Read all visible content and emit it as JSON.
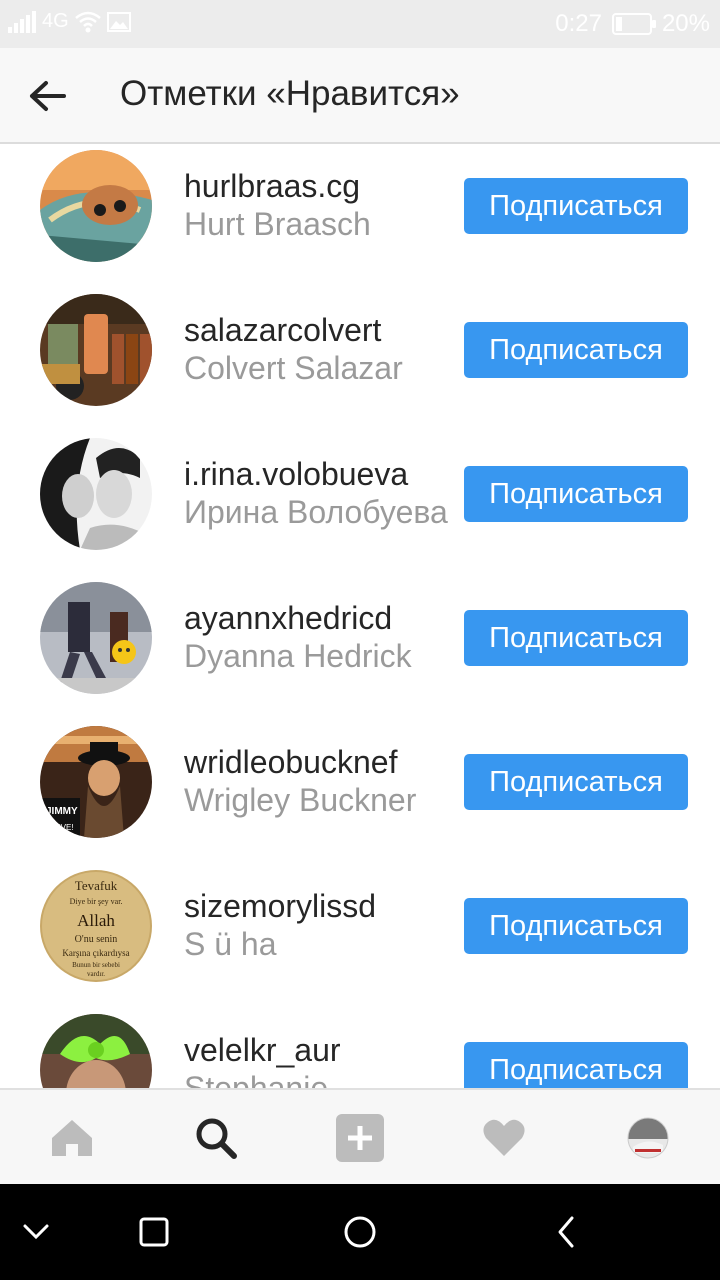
{
  "status_bar": {
    "network": "4G",
    "time": "0:27",
    "battery": "20%",
    "battery_level": 0.2
  },
  "header": {
    "back_icon": "arrow-left-icon",
    "title": "Отметки «Нравится»"
  },
  "likers": [
    {
      "username": "hurlbraas.cg",
      "full_name": "Hurt Braasch",
      "follow_label": "Подписаться"
    },
    {
      "username": "salazarcolvert",
      "full_name": "Colvert Salazar",
      "follow_label": "Подписаться"
    },
    {
      "username": "i.rina.volobueva",
      "full_name": "Ирина Волобуева",
      "follow_label": "Подписаться"
    },
    {
      "username": "ayannxhedricd",
      "full_name": "Dyanna Hedrick",
      "follow_label": "Подписаться"
    },
    {
      "username": "wridleobucknef",
      "full_name": "Wrigley Buckner",
      "follow_label": "Подписаться"
    },
    {
      "username": "sizemorylissd",
      "full_name": "S ü ha",
      "follow_label": "Подписаться"
    },
    {
      "username": "velelkr_aur",
      "full_name": "Stephanie",
      "follow_label": "Подписаться"
    }
  ],
  "avatar_texts": {
    "jimmy": "JIMMY",
    "live": "LIVE!",
    "tevafuk": "Tevafuk",
    "line1": "Diye bir şey var.",
    "allah": "Allah",
    "line2": "O'nu senin",
    "line3": "Karşına çıkardıysa",
    "line4": "Bunun bir sebebi",
    "line5": "vardır."
  },
  "tabs": [
    "home-icon",
    "search-icon",
    "add-post-icon",
    "activity-heart-icon",
    "profile-avatar-icon"
  ],
  "nav_bar": [
    "nav-collapse-icon",
    "nav-recents-icon",
    "nav-home-icon",
    "nav-back-icon"
  ],
  "colors": {
    "accent": "#3897f0",
    "text": "#262626",
    "secondary_text": "#9a9a9a"
  }
}
